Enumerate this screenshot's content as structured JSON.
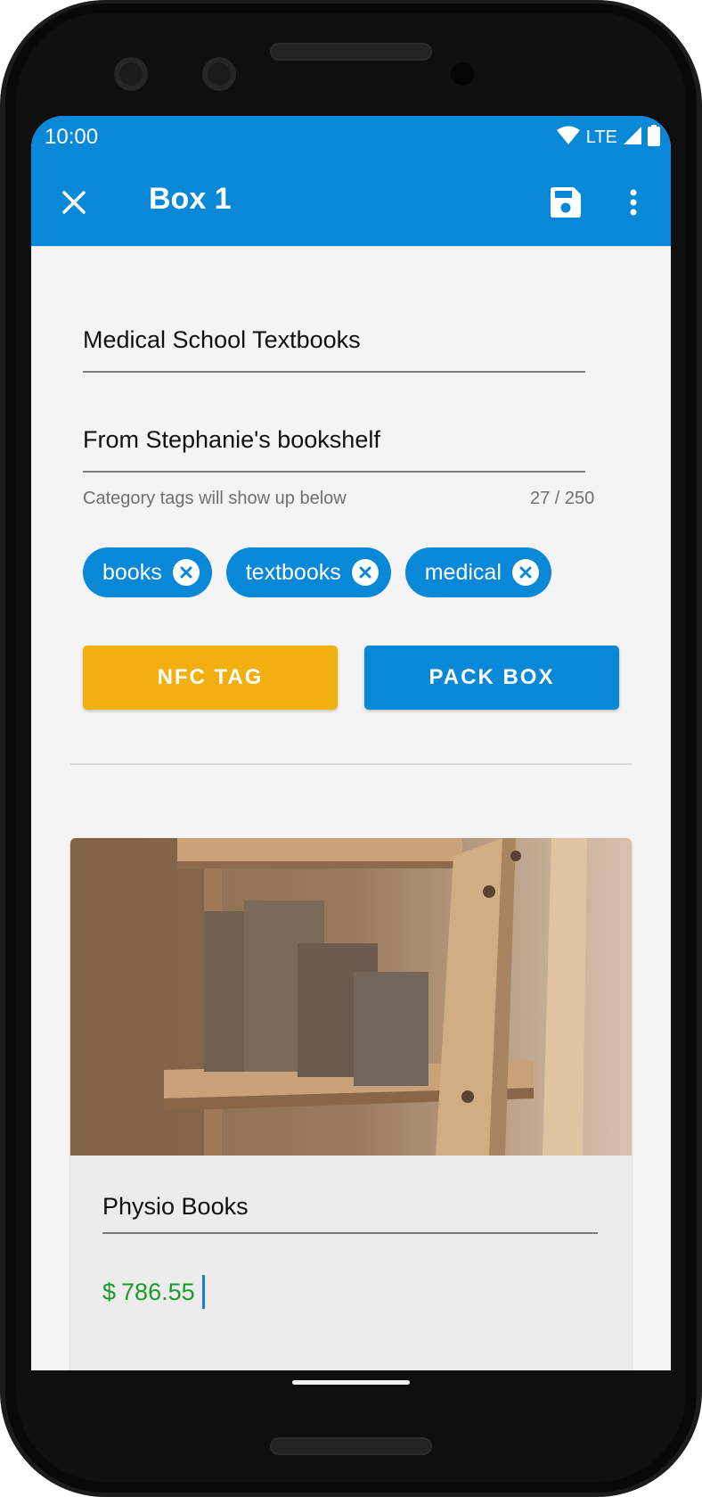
{
  "status_bar": {
    "time": "10:00",
    "network": "LTE",
    "icons": [
      "wifi-icon",
      "lte-signal-icon",
      "battery-icon"
    ]
  },
  "app_bar": {
    "title": "Box 1",
    "close_icon": "close-icon",
    "save_icon": "save-icon",
    "more_icon": "more-vert-icon"
  },
  "form": {
    "name_value": "Medical School Textbooks",
    "description_value": "From Stephanie's bookshelf",
    "helper_text": "Category tags will show up below",
    "counter": "27 / 250"
  },
  "tags": [
    {
      "label": "books"
    },
    {
      "label": "textbooks"
    },
    {
      "label": "medical"
    }
  ],
  "buttons": {
    "nfc_label": "NFC TAG",
    "pack_label": "PACK BOX"
  },
  "item_card": {
    "name_value": "Physio Books",
    "currency": "$",
    "price_value": "786.55"
  },
  "colors": {
    "primary": "#0a88d8",
    "accent": "#f2b010",
    "price": "#1c9a2a",
    "background": "#f4f4f4"
  }
}
